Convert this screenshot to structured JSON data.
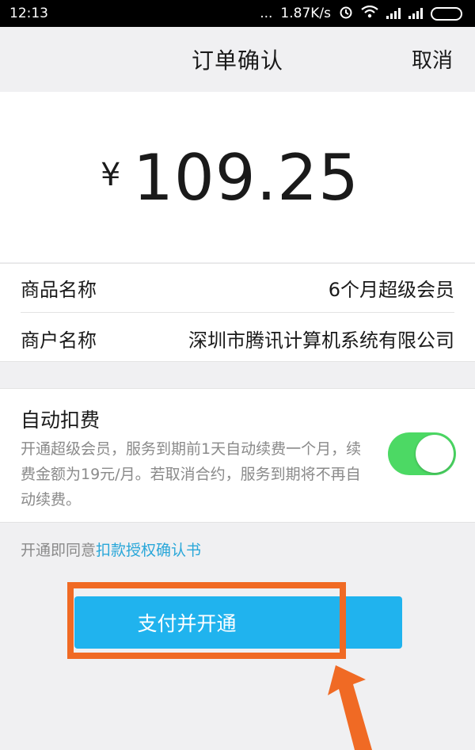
{
  "status_bar": {
    "time": "12:13",
    "dots": "...",
    "speed": "1.87K/s",
    "icons": [
      "alarm-icon",
      "wifi-icon",
      "signal-icon",
      "signal-icon",
      "battery-icon"
    ]
  },
  "nav": {
    "title": "订单确认",
    "cancel_label": "取消"
  },
  "amount": {
    "currency": "¥",
    "value": "109.25"
  },
  "info": {
    "rows": [
      {
        "label": "商品名称",
        "value": "6个月超级会员"
      },
      {
        "label": "商户名称",
        "value": "深圳市腾讯计算机系统有限公司"
      }
    ]
  },
  "auto_deduct": {
    "title": "自动扣费",
    "description": "开通超级会员，服务到期前1天自动续费一个月，续费金额为19元/月。若取消合约，服务到期将不再自动续费。",
    "enabled": true
  },
  "agreement": {
    "prefix": "开通即同意",
    "link": "扣款授权确认书"
  },
  "pay_button": {
    "label": "支付并开通"
  },
  "colors": {
    "accent_blue": "#20b3ee",
    "link_blue": "#2aa7d9",
    "toggle_green": "#4cd964",
    "annotation_orange": "#f06a24"
  }
}
